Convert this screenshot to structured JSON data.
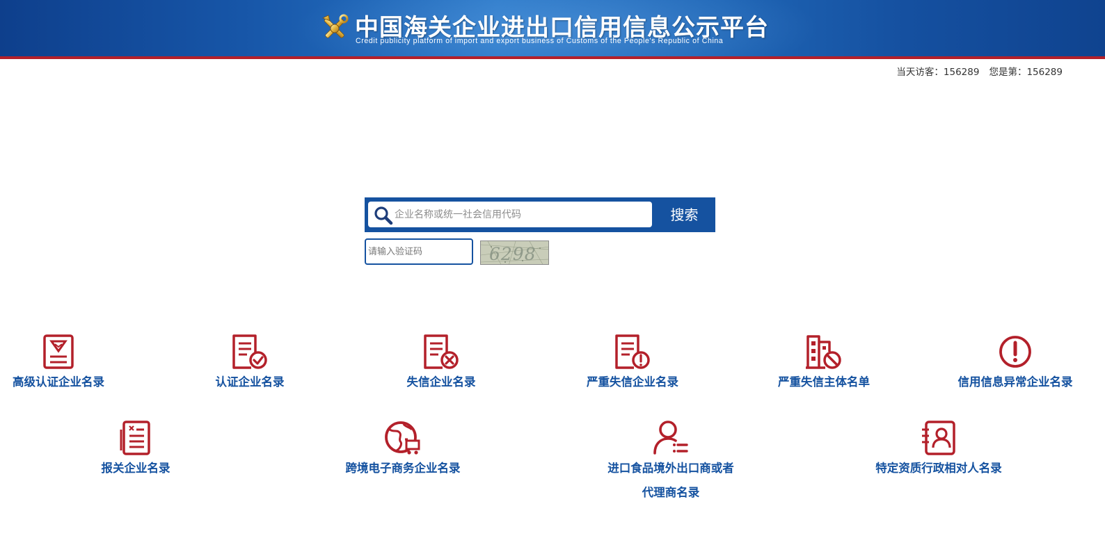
{
  "header": {
    "title": "中国海关企业进出口信用信息公示平台",
    "subtitle": "Credit publicity platform of import and export business of Customs of the People's Republic of China"
  },
  "visitors": {
    "today_label": "当天访客：",
    "today_count": "156289",
    "rank_label": "您是第：",
    "rank_count": "156289"
  },
  "search": {
    "placeholder": "企业名称或统一社会信用代码",
    "button_label": "搜索",
    "captcha_placeholder": "请输入验证码",
    "captcha_text": "6298"
  },
  "categories": [
    {
      "label": "高级认证企业名录",
      "icon": "advanced-certified-document-icon"
    },
    {
      "label": "认证企业名录",
      "icon": "certified-document-check-icon"
    },
    {
      "label": "失信企业名录",
      "icon": "dishonest-document-x-icon"
    },
    {
      "label": "严重失信企业名录",
      "icon": "serious-dishonest-document-alert-icon"
    },
    {
      "label": "严重失信主体名单",
      "icon": "building-prohibited-icon"
    },
    {
      "label": "信用信息异常企业名录",
      "icon": "exclamation-circle-icon"
    },
    {
      "label": "报关企业名录",
      "icon": "customs-declaration-document-icon"
    },
    {
      "label": "跨境电子商务企业名录",
      "icon": "globe-cart-icon"
    },
    {
      "label": "进口食品境外出口商或者",
      "label_line2": "代理商名录",
      "icon": "person-list-icon"
    },
    {
      "label": "特定资质行政相对人名录",
      "icon": "person-card-icon"
    }
  ],
  "colors": {
    "brand_blue": "#1552a0",
    "icon_red": "#b3202a",
    "banner_border": "#b3202a"
  }
}
